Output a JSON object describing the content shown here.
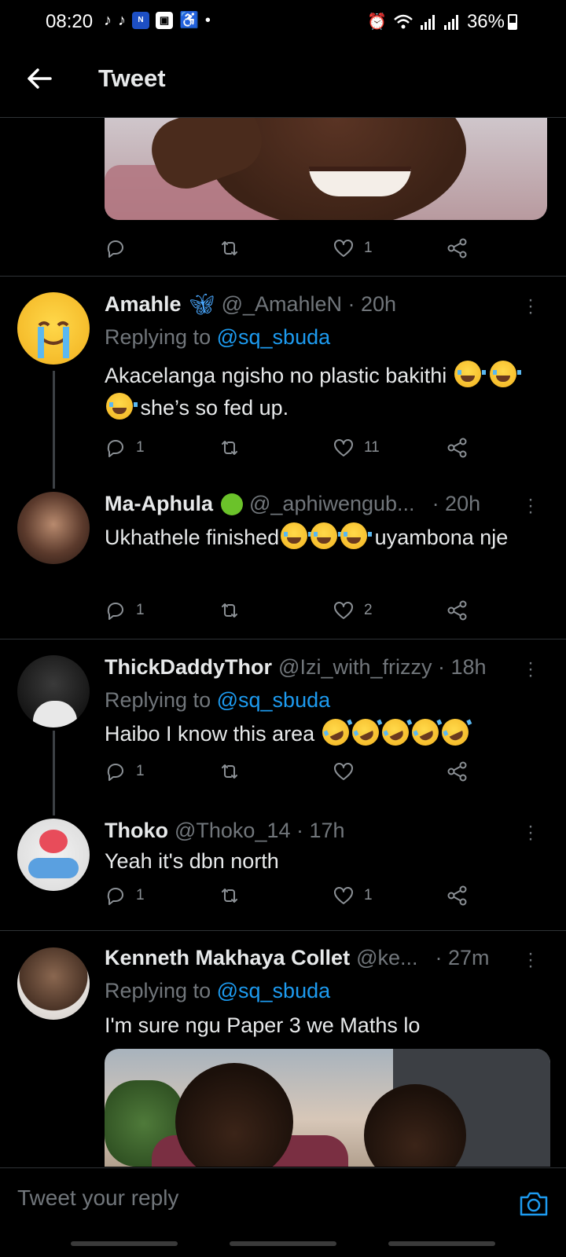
{
  "status_bar": {
    "time": "08:20",
    "battery": "36%",
    "left_icons": [
      "tiktok-icon",
      "tiktok-icon",
      "news-app-icon",
      "gallery-app-icon",
      "accessibility-icon",
      "dot-icon"
    ],
    "right_icons": [
      "alarm-icon",
      "wifi-icon",
      "signal-icon",
      "signal-icon",
      "battery-icon"
    ]
  },
  "header": {
    "title": "Tweet"
  },
  "top_tweet_actions": {
    "reply_count": "",
    "retweet_count": "",
    "like_count": "1"
  },
  "tweets": [
    {
      "name": "Amahle",
      "badge": "butterfly-emoji",
      "meta": "@_AmahleN · 20h",
      "replying_label": "Replying to",
      "replying_handle": "@sq_sbuda",
      "text_parts": [
        "Akacelanga ngisho no plastic bakithi",
        "she’s so fed up."
      ],
      "reply_count": "1",
      "retweet_count": "",
      "like_count": "11"
    },
    {
      "name": "Ma-Aphula",
      "badge": "green-apple-emoji",
      "meta": "@_aphiwengub...",
      "time": "· 20h",
      "text_parts": [
        "Ukhathele finished",
        "uyambona nje"
      ],
      "reply_count": "1",
      "retweet_count": "",
      "like_count": "2"
    },
    {
      "name": "ThickDaddyThor",
      "meta": "@Izi_with_frizzy · 18h",
      "replying_label": "Replying to",
      "replying_handle": "@sq_sbuda",
      "text_parts": [
        "Haibo I know this area"
      ],
      "reply_count": "1",
      "retweet_count": "",
      "like_count": ""
    },
    {
      "name": "Thoko",
      "meta": "@Thoko_14 · 17h",
      "text_parts": [
        "Yeah it's dbn north"
      ],
      "reply_count": "1",
      "retweet_count": "",
      "like_count": "1"
    },
    {
      "name": "Kenneth Makhaya Collet",
      "meta": "@ke...",
      "time": "· 27m",
      "replying_label": "Replying to",
      "replying_handle": "@sq_sbuda",
      "text_parts": [
        "I'm sure ngu Paper 3 we Maths lo"
      ]
    }
  ],
  "reply_bar": {
    "placeholder": "Tweet your reply"
  },
  "colors": {
    "background": "#000000",
    "accent": "#1d9bf0",
    "secondary_text": "#71767b",
    "divider": "#2f3336"
  }
}
